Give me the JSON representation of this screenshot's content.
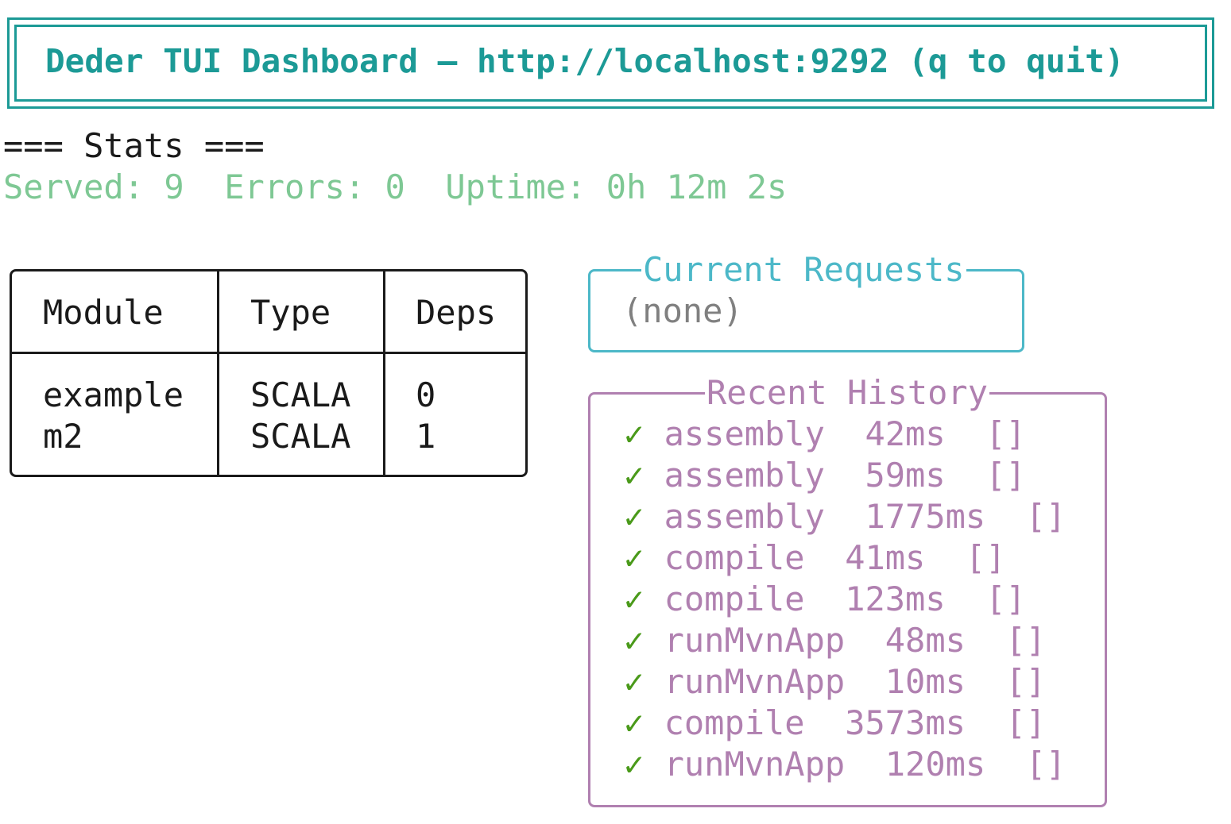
{
  "header": {
    "title": "Deder TUI Dashboard — http://localhost:9292 (q to quit)"
  },
  "stats": {
    "heading": "=== Stats ===",
    "served_label": "Served:",
    "served": "9",
    "errors_label": "Errors:",
    "errors": "0",
    "uptime_label": "Uptime:",
    "uptime": "0h 12m 2s"
  },
  "modules": {
    "headers": [
      "Module",
      "Type",
      "Deps"
    ],
    "rows": [
      {
        "module": "example",
        "type": "SCALA",
        "deps": "0"
      },
      {
        "module": "m2",
        "type": "SCALA",
        "deps": "1"
      }
    ]
  },
  "current_requests": {
    "title": "Current Requests",
    "empty_text": "(none)"
  },
  "recent_history": {
    "title": "Recent History",
    "items": [
      {
        "status": "✓",
        "task": "assembly",
        "duration": "42ms",
        "args": "[]"
      },
      {
        "status": "✓",
        "task": "assembly",
        "duration": "59ms",
        "args": "[]"
      },
      {
        "status": "✓",
        "task": "assembly",
        "duration": "1775ms",
        "args": "[]"
      },
      {
        "status": "✓",
        "task": "compile",
        "duration": "41ms",
        "args": "[]"
      },
      {
        "status": "✓",
        "task": "compile",
        "duration": "123ms",
        "args": "[]"
      },
      {
        "status": "✓",
        "task": "runMvnApp",
        "duration": "48ms",
        "args": "[]"
      },
      {
        "status": "✓",
        "task": "runMvnApp",
        "duration": "10ms",
        "args": "[]"
      },
      {
        "status": "✓",
        "task": "compile",
        "duration": "3573ms",
        "args": "[]"
      },
      {
        "status": "✓",
        "task": "runMvnApp",
        "duration": "120ms",
        "args": "[]"
      }
    ]
  },
  "colors": {
    "header": "#1c9a96",
    "stats": "#7ec894",
    "requests_border": "#4cb8c8",
    "history": "#b080b0",
    "check": "#4a9a1a",
    "muted": "#808080"
  }
}
